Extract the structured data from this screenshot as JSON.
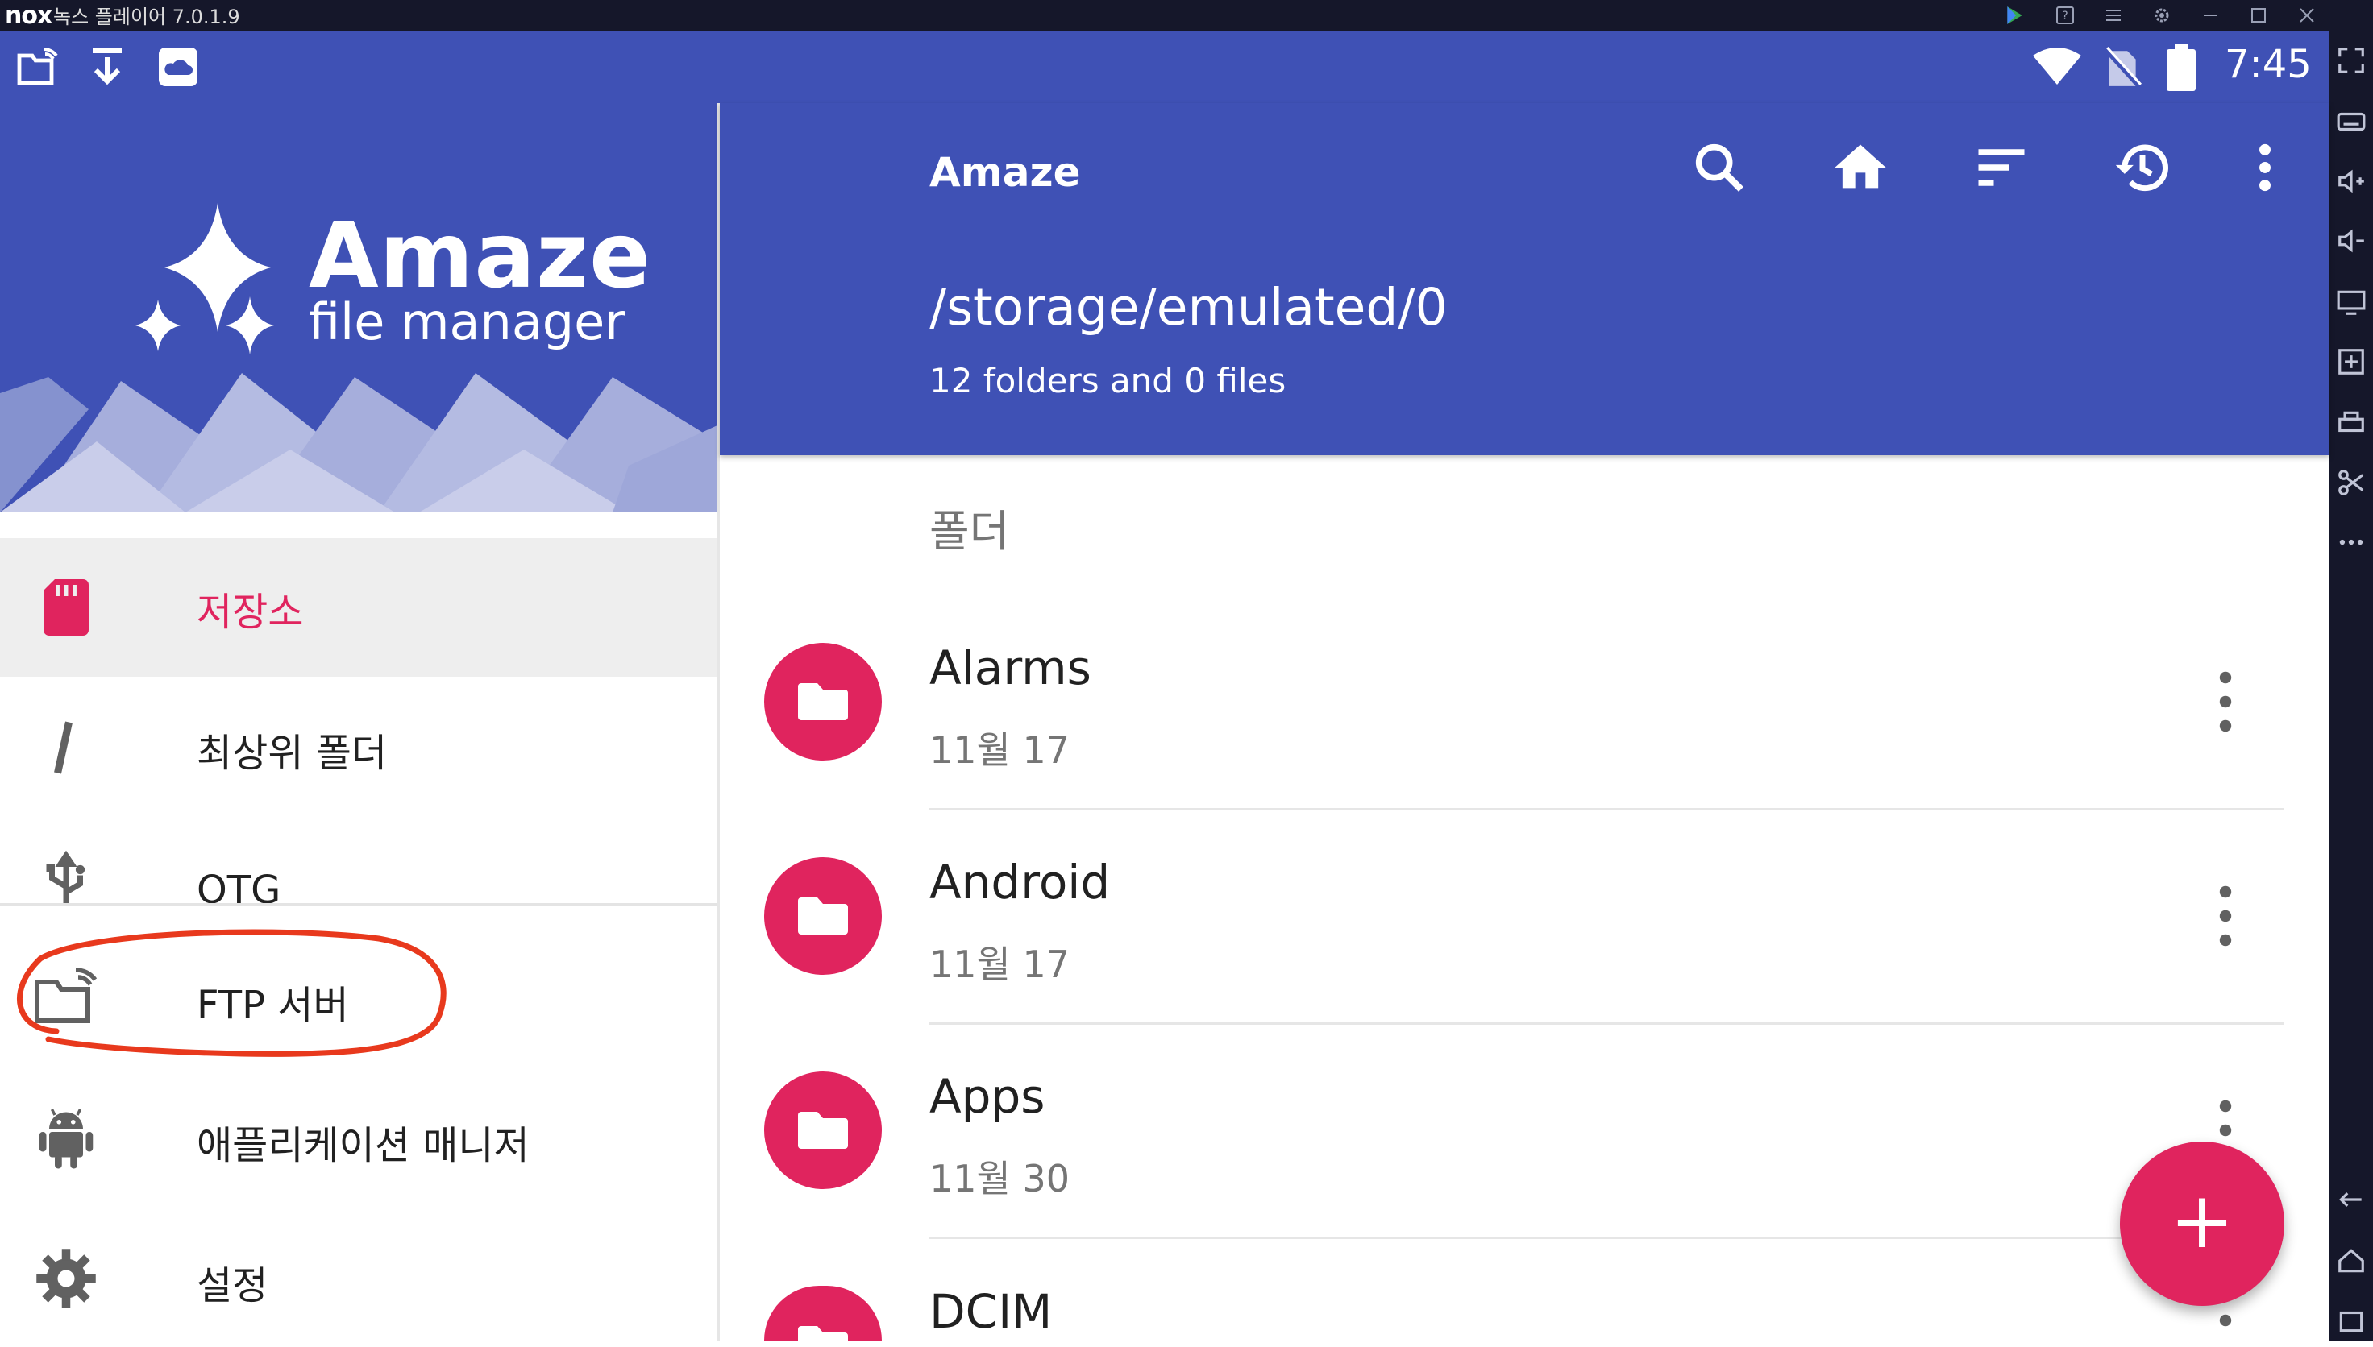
{
  "emulator": {
    "logo": "nox",
    "title": "녹스 플레이어 7.0.1.9",
    "window_buttons": [
      "play-icon",
      "help-icon",
      "menu-icon",
      "settings-icon",
      "minimize-icon",
      "maximize-icon",
      "close-icon"
    ]
  },
  "status_bar": {
    "left_icons": [
      "ftp-folder-icon",
      "download-icon",
      "cloud-icon"
    ],
    "right_icons": [
      "wifi-icon",
      "no-sim-icon",
      "battery-icon"
    ],
    "time": "7:45"
  },
  "drawer": {
    "brand_title": "Amaze",
    "brand_subtitle": "file manager",
    "items": [
      {
        "label": "저장소",
        "icon": "sd-card-icon",
        "active": true
      },
      {
        "label": "최상위 폴더",
        "icon": "root-slash-icon",
        "active": false
      },
      {
        "label": "OTG",
        "icon": "usb-icon",
        "active": false
      },
      {
        "label": "FTP 서버",
        "icon": "ftp-folder-icon",
        "active": false
      },
      {
        "label": "애플리케이션 매니저",
        "icon": "android-icon",
        "active": false
      },
      {
        "label": "설정",
        "icon": "gear-icon",
        "active": false
      }
    ]
  },
  "appbar": {
    "title": "Amaze",
    "actions": [
      "search-icon",
      "home-icon",
      "sort-icon",
      "history-icon",
      "more-vert-icon"
    ],
    "path": "/storage/emulated/0",
    "summary": "12 folders and 0 files"
  },
  "list": {
    "section_header": "폴더",
    "items": [
      {
        "name": "Alarms",
        "date": "11월 17"
      },
      {
        "name": "Android",
        "date": "11월 17"
      },
      {
        "name": "Apps",
        "date": "11월 30"
      },
      {
        "name": "DCIM",
        "date": ""
      }
    ]
  },
  "fab": {
    "label": "+"
  },
  "colors": {
    "primary": "#3f51b5",
    "accent": "#e0245e",
    "annotation": "#e8391d"
  }
}
